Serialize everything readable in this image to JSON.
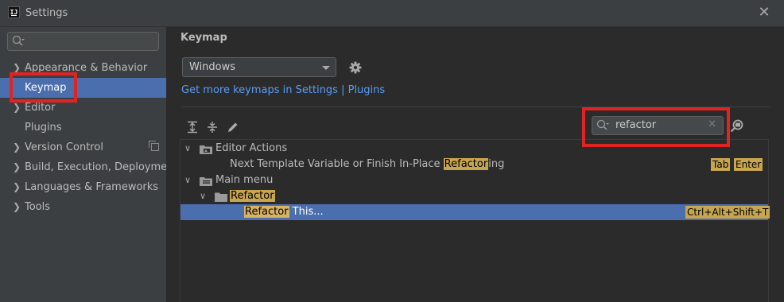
{
  "window": {
    "title": "Settings",
    "app_icon_text": "IJ",
    "close_glyph": "✕"
  },
  "sidebar": {
    "search_placeholder": "",
    "items": [
      {
        "label": "Appearance & Behavior",
        "expandable": true
      },
      {
        "label": "Keymap",
        "expandable": false,
        "selected": true
      },
      {
        "label": "Editor",
        "expandable": true
      },
      {
        "label": "Plugins",
        "expandable": false
      },
      {
        "label": "Version Control",
        "expandable": true,
        "badge_icon": "copy-icon"
      },
      {
        "label": "Build, Execution, Deployment",
        "expandable": true
      },
      {
        "label": "Languages & Frameworks",
        "expandable": true
      },
      {
        "label": "Tools",
        "expandable": true
      }
    ]
  },
  "main": {
    "title": "Keymap",
    "keymap_select": {
      "value": "Windows"
    },
    "link_text": "Get more keymaps in Settings | Plugins",
    "toolbar_icons": [
      "expand-all-icon",
      "collapse-all-icon",
      "edit-icon"
    ],
    "filter": {
      "value": "refactor"
    }
  },
  "keymap_tree": [
    {
      "name": "Editor Actions",
      "prefix": "",
      "match": "",
      "suffix": "Editor Actions",
      "icon": "folder-actions-icon",
      "expanded": true
    },
    {
      "name": "Next Template Variable or Finish In-Place Refactoring",
      "prefix": "Next Template Variable or Finish In-Place ",
      "match": "Refactor",
      "suffix": "ing",
      "shortcuts": [
        "Tab",
        "Enter"
      ]
    },
    {
      "name": "Main menu",
      "prefix": "",
      "match": "",
      "suffix": "Main menu",
      "icon": "menu-folder-icon",
      "expanded": true
    },
    {
      "name": "Refactor",
      "prefix": "",
      "match": "Refactor",
      "suffix": "",
      "icon": "folder-icon",
      "expanded": true
    },
    {
      "name": "Refactor This...",
      "prefix": "",
      "match": "Refactor",
      "suffix": " This...",
      "shortcuts": [
        "Ctrl+Alt+Shift+T"
      ],
      "selected": true
    }
  ],
  "colors": {
    "accent_selection": "#4b6eaf",
    "search_highlight": "#c8a64f",
    "link": "#589df6",
    "annotation_box": "#e02424"
  }
}
